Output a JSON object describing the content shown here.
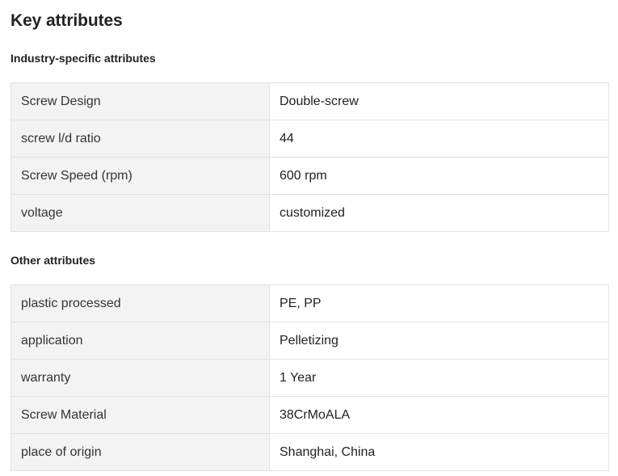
{
  "title": "Key attributes",
  "sections": [
    {
      "heading": "Industry-specific attributes",
      "rows": [
        {
          "key": "Screw Design",
          "value": "Double-screw"
        },
        {
          "key": "screw l/d ratio",
          "value": "44"
        },
        {
          "key": "Screw Speed (rpm)",
          "value": "600 rpm"
        },
        {
          "key": "voltage",
          "value": "customized"
        }
      ]
    },
    {
      "heading": "Other attributes",
      "rows": [
        {
          "key": "plastic processed",
          "value": "PE, PP"
        },
        {
          "key": "application",
          "value": "Pelletizing"
        },
        {
          "key": "warranty",
          "value": "1 Year"
        },
        {
          "key": "Screw Material",
          "value": "38CrMoALA"
        },
        {
          "key": "place of origin",
          "value": "Shanghai, China"
        }
      ]
    }
  ]
}
